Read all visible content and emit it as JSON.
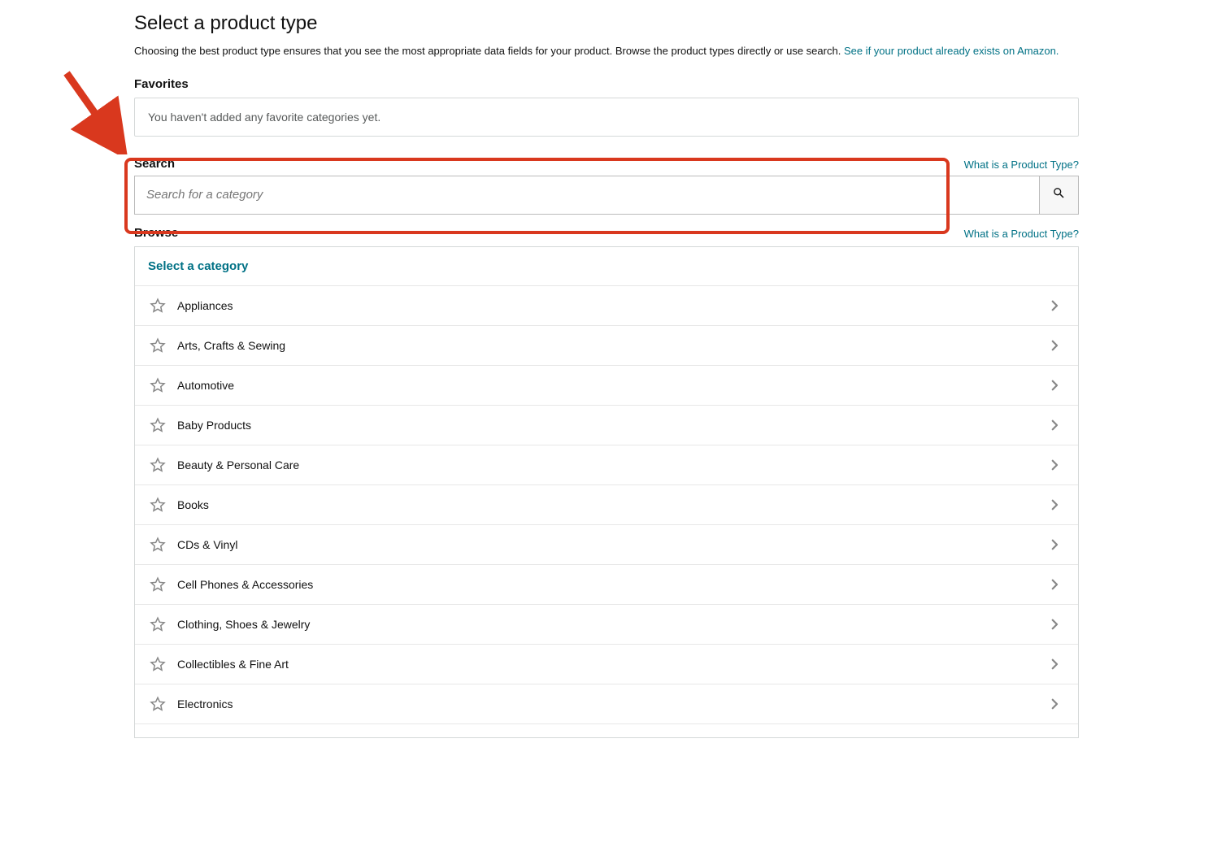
{
  "page": {
    "title": "Select a product type",
    "description_text": "Choosing the best product type ensures that you see the most appropriate data fields for your product. Browse the product types directly or use search. ",
    "description_link": "See if your product already exists on Amazon."
  },
  "favorites": {
    "heading": "Favorites",
    "empty_text": "You haven't added any favorite categories yet."
  },
  "search": {
    "heading": "Search",
    "help_link": "What is a Product Type?",
    "placeholder": "Search for a category"
  },
  "browse": {
    "heading": "Browse",
    "help_link": "What is a Product Type?",
    "select_header": "Select a category",
    "categories": [
      "Appliances",
      "Arts, Crafts & Sewing",
      "Automotive",
      "Baby Products",
      "Beauty & Personal Care",
      "Books",
      "CDs & Vinyl",
      "Cell Phones & Accessories",
      "Clothing, Shoes & Jewelry",
      "Collectibles & Fine Art",
      "Electronics"
    ]
  }
}
